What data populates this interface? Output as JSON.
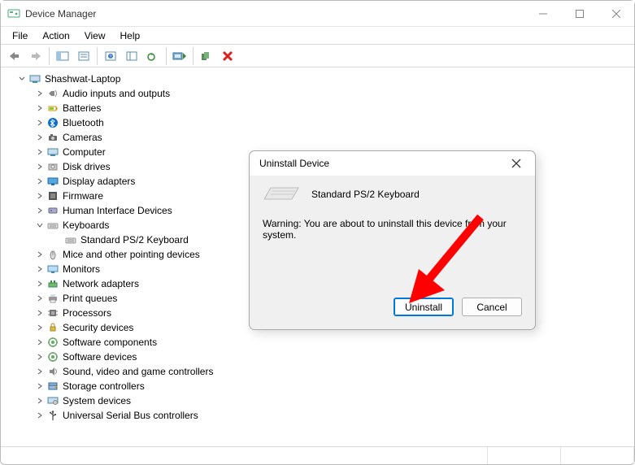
{
  "window": {
    "title": "Device Manager"
  },
  "menu": {
    "items": [
      "File",
      "Action",
      "View",
      "Help"
    ]
  },
  "tree": {
    "root": "Shashwat-Laptop",
    "nodes": [
      {
        "label": "Audio inputs and outputs",
        "icon": "audio"
      },
      {
        "label": "Batteries",
        "icon": "battery"
      },
      {
        "label": "Bluetooth",
        "icon": "bluetooth"
      },
      {
        "label": "Cameras",
        "icon": "camera"
      },
      {
        "label": "Computer",
        "icon": "computer"
      },
      {
        "label": "Disk drives",
        "icon": "disk"
      },
      {
        "label": "Display adapters",
        "icon": "display"
      },
      {
        "label": "Firmware",
        "icon": "firmware"
      },
      {
        "label": "Human Interface Devices",
        "icon": "hid"
      },
      {
        "label": "Keyboards",
        "icon": "keyboard",
        "expanded": true,
        "children": [
          {
            "label": "Standard PS/2 Keyboard",
            "icon": "keyboard"
          }
        ]
      },
      {
        "label": "Mice and other pointing devices",
        "icon": "mouse"
      },
      {
        "label": "Monitors",
        "icon": "monitor"
      },
      {
        "label": "Network adapters",
        "icon": "network"
      },
      {
        "label": "Print queues",
        "icon": "printer"
      },
      {
        "label": "Processors",
        "icon": "cpu"
      },
      {
        "label": "Security devices",
        "icon": "security"
      },
      {
        "label": "Software components",
        "icon": "software"
      },
      {
        "label": "Software devices",
        "icon": "software"
      },
      {
        "label": "Sound, video and game controllers",
        "icon": "sound"
      },
      {
        "label": "Storage controllers",
        "icon": "storage"
      },
      {
        "label": "System devices",
        "icon": "system"
      },
      {
        "label": "Universal Serial Bus controllers",
        "icon": "usb"
      }
    ]
  },
  "dialog": {
    "title": "Uninstall Device",
    "device_name": "Standard PS/2 Keyboard",
    "warning": "Warning: You are about to uninstall this device from your system.",
    "buttons": {
      "uninstall": "Uninstall",
      "cancel": "Cancel"
    }
  }
}
